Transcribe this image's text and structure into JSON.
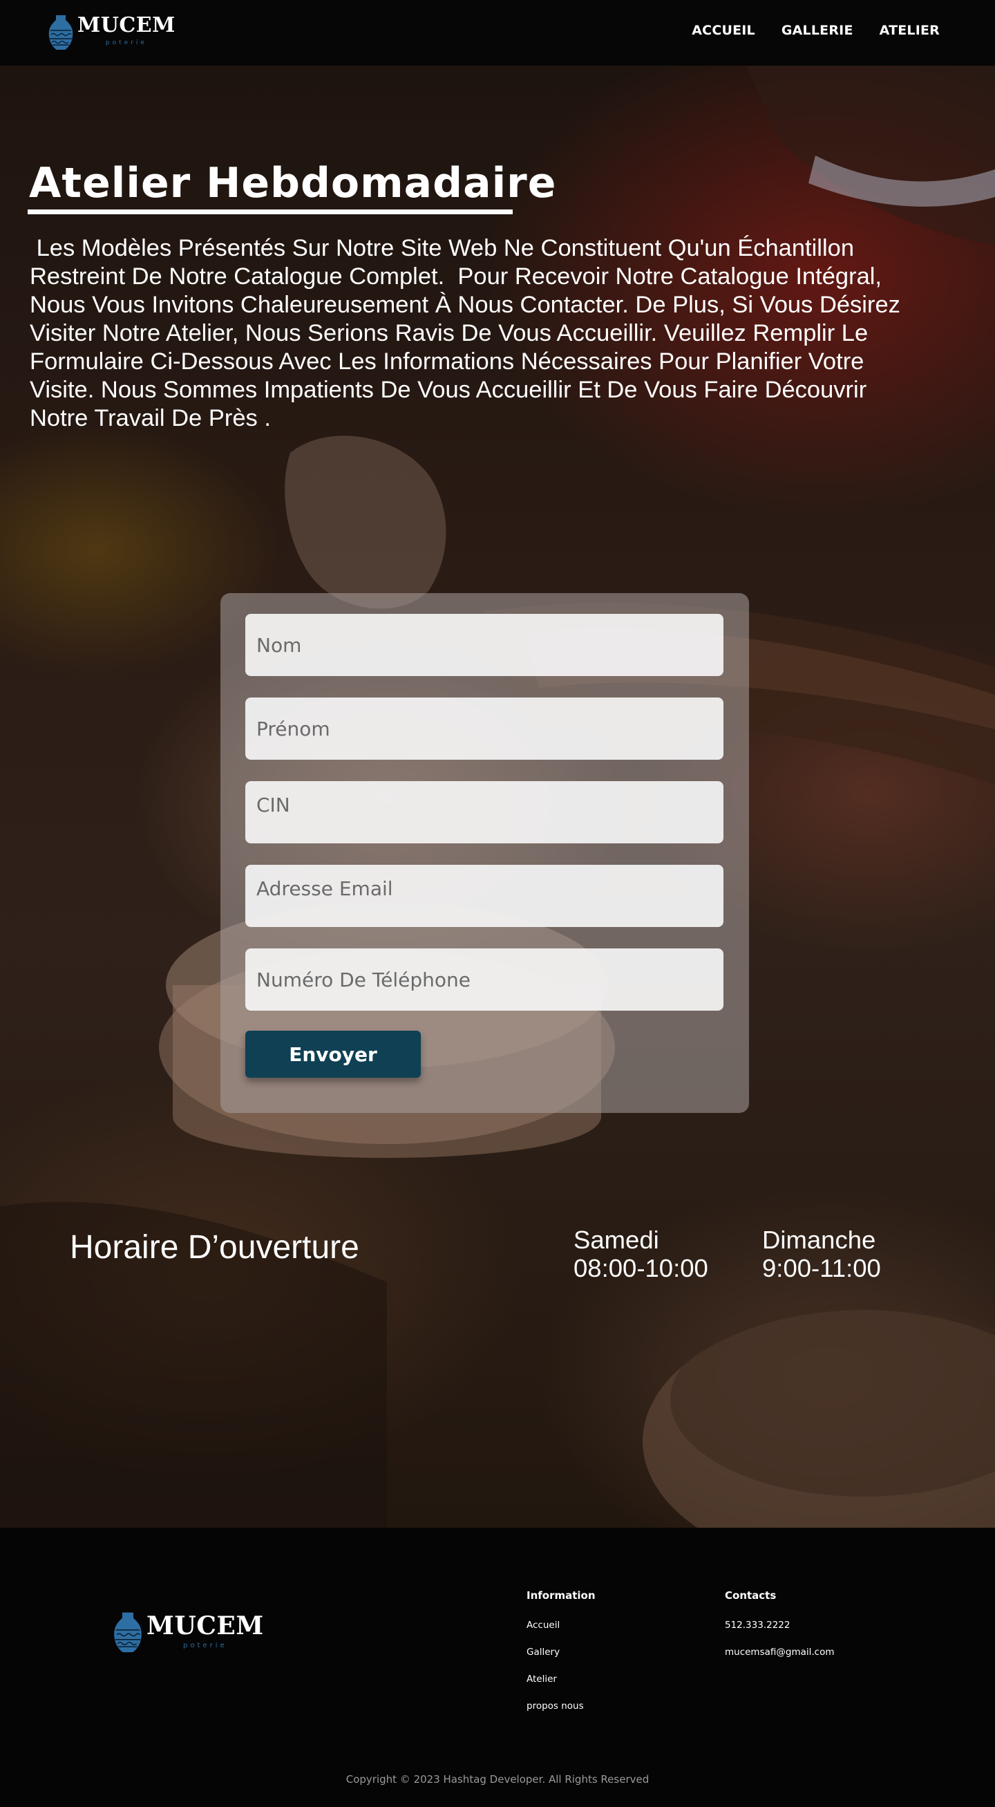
{
  "brand": {
    "name": "MUCEM",
    "tagline": "poterie",
    "color": "#2d6ea3"
  },
  "nav": {
    "items": [
      {
        "label": "ACCUEIL"
      },
      {
        "label": "GALLERIE"
      },
      {
        "label": "ATELIER"
      }
    ]
  },
  "hero": {
    "title": "Atelier Hebdomadaire",
    "text": " Les Modèles Présentés Sur Notre Site Web Ne Constituent Qu'un Échantillon\nRestreint De Notre Catalogue Complet.  Pour Recevoir Notre Catalogue Intégral,\nNous Vous Invitons Chaleureusement À Nous Contacter. De Plus, Si Vous Désirez\nVisiter Notre Atelier, Nous Serions Ravis De Vous Accueillir. Veuillez Remplir Le\nFormulaire Ci-Dessous Avec Les Informations Nécessaires Pour Planifier Votre\nVisite. Nous Sommes Impatients De Vous Accueillir Et De Vous Faire Découvrir\nNotre Travail De Près ."
  },
  "form": {
    "nom_placeholder": "Nom",
    "prenom_placeholder": "Prénom",
    "cin_placeholder": "CIN",
    "email_placeholder": "Adresse Email",
    "phone_placeholder": "Numéro De Téléphone",
    "submit_label": "Envoyer",
    "submit_color": "#0f4054"
  },
  "hours": {
    "title": "Horaire D’ouverture",
    "days": [
      {
        "day": "Samedi",
        "time": "08:00-10:00"
      },
      {
        "day": "Dimanche",
        "time": "9:00-11:00"
      }
    ]
  },
  "footer": {
    "information": {
      "title": "Information",
      "links": [
        "Accueil",
        "Gallery",
        "Atelier",
        "propos nous"
      ]
    },
    "contacts": {
      "title": "Contacts",
      "phone": "512.333.2222",
      "email": "mucemsafi@gmail.com"
    },
    "copyright": "Copyright © 2023 Hashtag Developer. All Rights Reserved"
  }
}
